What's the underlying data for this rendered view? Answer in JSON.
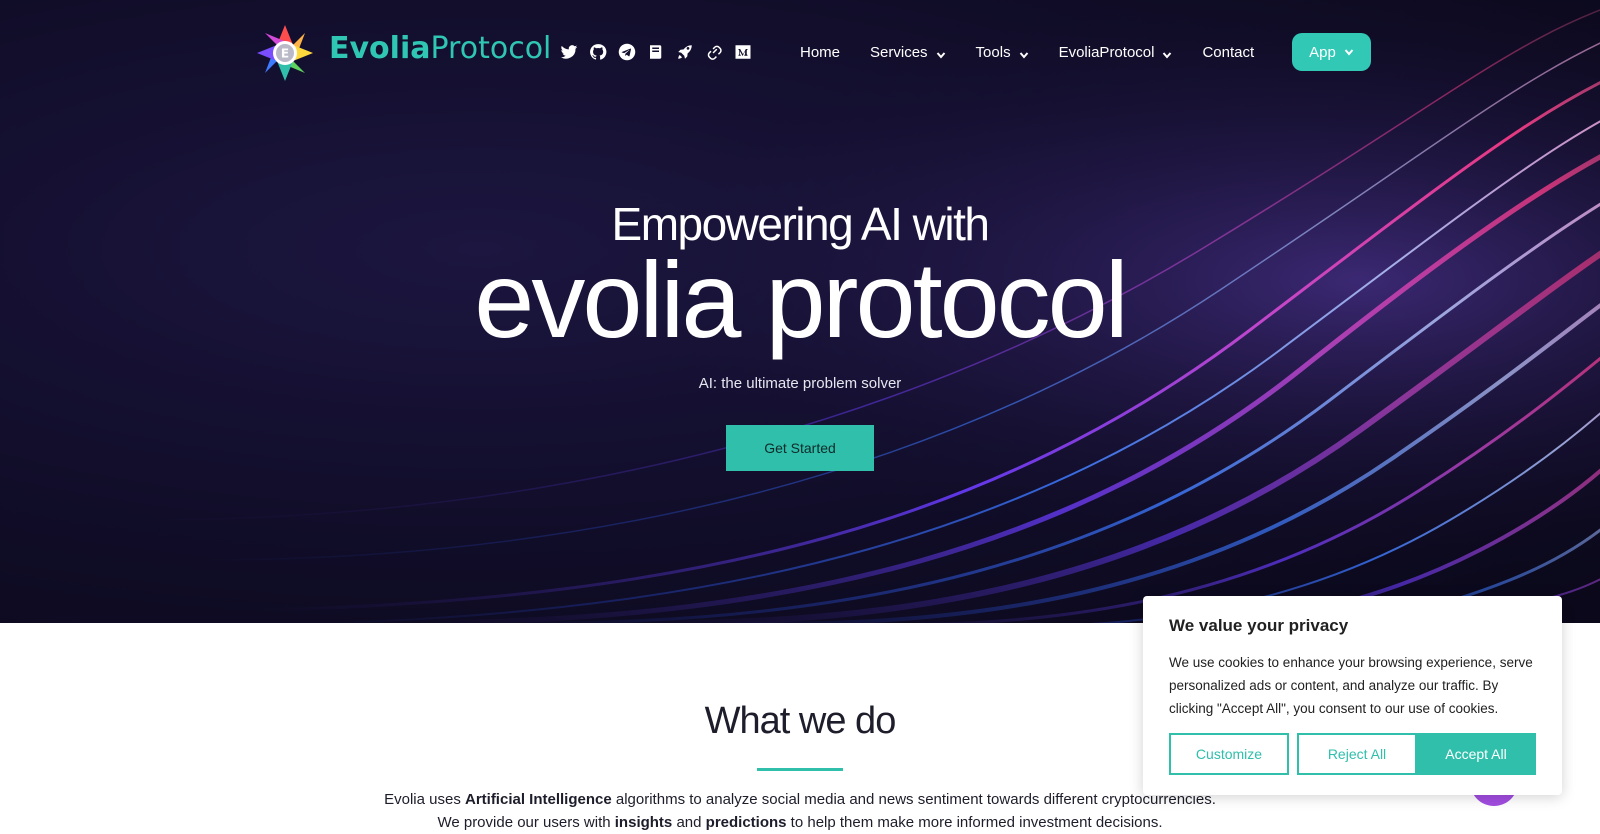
{
  "brand": {
    "bold": "Evolia",
    "light": "Protocol",
    "logo_letter": "E"
  },
  "social_icons": [
    "twitter-icon",
    "github-icon",
    "telegram-icon",
    "book-icon",
    "rocket-icon",
    "link-icon",
    "medium-icon"
  ],
  "nav": {
    "home": "Home",
    "services": "Services",
    "tools": "Tools",
    "evolia": "EvoliaProtocol",
    "contact": "Contact",
    "app": "App"
  },
  "hero": {
    "subtitle": "Empowering AI with",
    "title": "evolia protocol",
    "tagline": "AI: the ultimate problem solver",
    "cta": "Get Started"
  },
  "what_we_do": {
    "title": "What we do",
    "line1": {
      "a": "Evolia uses ",
      "b": "Artificial Intelligence",
      "c": " algorithms to analyze social media and news sentiment towards different cryptocurrencies."
    },
    "line2": {
      "a": "We provide our users with ",
      "b": "insights",
      "c": " and ",
      "d": "predictions",
      "e": " to help them make more informed investment decisions."
    }
  },
  "cookie": {
    "title": "We value your privacy",
    "body": "We use cookies to enhance your browsing experience, serve personalized ads or content, and analyze our traffic. By clicking \"Accept All\", you consent to our use of cookies.",
    "customize": "Customize",
    "reject": "Reject All",
    "accept": "Accept All"
  },
  "colors": {
    "accent": "#2fbfab",
    "hero_bg": "#120e2c",
    "text_dark": "#1d1d2b"
  }
}
